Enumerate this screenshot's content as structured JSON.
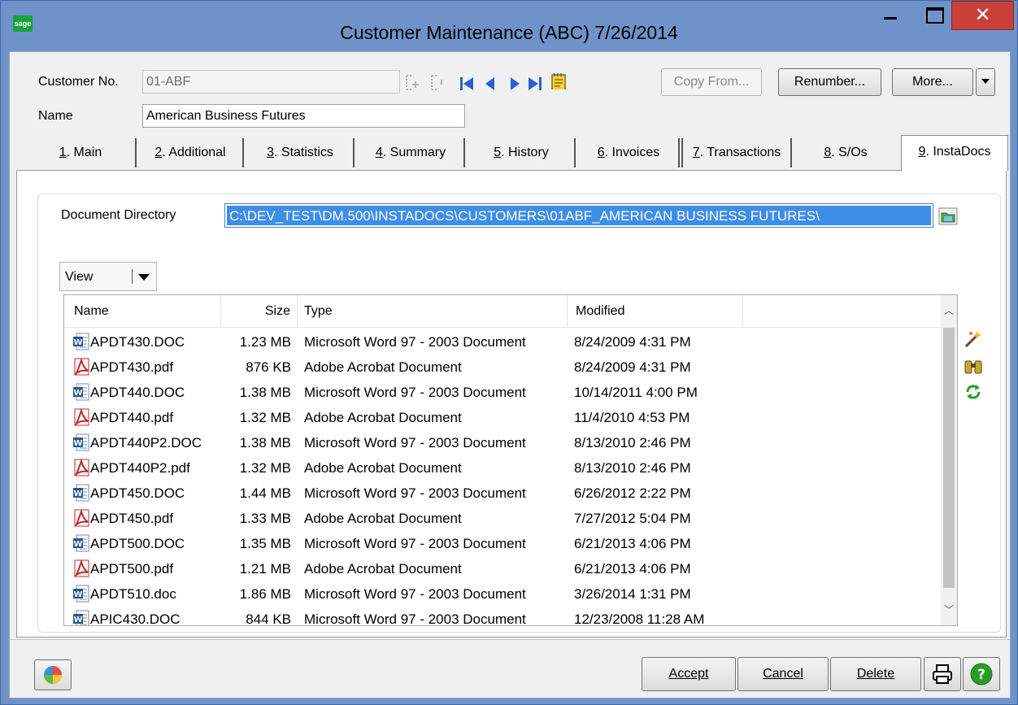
{
  "window": {
    "app_icon": "sage",
    "title": "Customer Maintenance (ABC) 7/26/2014",
    "minimize_icon": "minimize-icon",
    "maximize_icon": "maximize-icon",
    "close_glyph": "✕"
  },
  "header": {
    "customer_no_label": "Customer No.",
    "customer_no_value": "01-ABF",
    "name_label": "Name",
    "name_value": "American Business Futures",
    "copy_from": "Copy From...",
    "renumber": "Renumber...",
    "more": "More..."
  },
  "tabs": [
    {
      "num": "1",
      "label": ". Main"
    },
    {
      "num": "2",
      "label": ". Additional"
    },
    {
      "num": "3",
      "label": ". Statistics"
    },
    {
      "num": "4",
      "label": ". Summary"
    },
    {
      "num": "5",
      "label": ". History"
    },
    {
      "num": "6",
      "label": ". Invoices"
    },
    {
      "num": "7",
      "label": ". Transactions"
    },
    {
      "num": "8",
      "label": ". S/Os"
    },
    {
      "num": "9",
      "label": ". InstaDocs"
    }
  ],
  "instadocs": {
    "doc_dir_label": "Document Directory",
    "doc_dir_value": "C:\\DEV_TEST\\DM.500\\INSTADOCS\\CUSTOMERS\\01ABF_AMERICAN BUSINESS FUTURES\\",
    "view_label": "View",
    "columns": {
      "name": "Name",
      "size": "Size",
      "type": "Type",
      "modified": "Modified"
    },
    "files": [
      {
        "name": "APDT430.DOC",
        "size": "1.23 MB",
        "type": "Microsoft Word 97 - 2003 Document",
        "modified": "8/24/2009 4:31 PM",
        "icon": "word"
      },
      {
        "name": "APDT430.pdf",
        "size": "876 KB",
        "type": "Adobe Acrobat Document",
        "modified": "8/24/2009 4:31 PM",
        "icon": "pdf"
      },
      {
        "name": "APDT440.DOC",
        "size": "1.38 MB",
        "type": "Microsoft Word 97 - 2003 Document",
        "modified": "10/14/2011 4:00 PM",
        "icon": "word"
      },
      {
        "name": "APDT440.pdf",
        "size": "1.32 MB",
        "type": "Adobe Acrobat Document",
        "modified": "11/4/2010 4:53 PM",
        "icon": "pdf"
      },
      {
        "name": "APDT440P2.DOC",
        "size": "1.38 MB",
        "type": "Microsoft Word 97 - 2003 Document",
        "modified": "8/13/2010 2:46 PM",
        "icon": "word"
      },
      {
        "name": "APDT440P2.pdf",
        "size": "1.32 MB",
        "type": "Adobe Acrobat Document",
        "modified": "8/13/2010 2:46 PM",
        "icon": "pdf"
      },
      {
        "name": "APDT450.DOC",
        "size": "1.44 MB",
        "type": "Microsoft Word 97 - 2003 Document",
        "modified": "6/26/2012 2:22 PM",
        "icon": "word"
      },
      {
        "name": "APDT450.pdf",
        "size": "1.33 MB",
        "type": "Adobe Acrobat Document",
        "modified": "7/27/2012 5:04 PM",
        "icon": "pdf"
      },
      {
        "name": "APDT500.DOC",
        "size": "1.35 MB",
        "type": "Microsoft Word 97 - 2003 Document",
        "modified": "6/21/2013 4:06 PM",
        "icon": "word"
      },
      {
        "name": "APDT500.pdf",
        "size": "1.21 MB",
        "type": "Adobe Acrobat Document",
        "modified": "6/21/2013 4:06 PM",
        "icon": "pdf"
      },
      {
        "name": "APDT510.doc",
        "size": "1.86 MB",
        "type": "Microsoft Word 97 - 2003 Document",
        "modified": "3/26/2014 1:31 PM",
        "icon": "word"
      },
      {
        "name": "APIC430.DOC",
        "size": "844 KB",
        "type": "Microsoft Word 97 - 2003 Document",
        "modified": "12/23/2008 11:28 AM",
        "icon": "word"
      }
    ]
  },
  "footer": {
    "accept": "Accept",
    "cancel": "Cancel",
    "delete": "Delete"
  },
  "colors": {
    "titlebar": "#6f93c9",
    "close": "#c9403a",
    "selection": "#3d8ee8",
    "word_blue": "#2b5797",
    "pdf_red": "#c0282a"
  }
}
